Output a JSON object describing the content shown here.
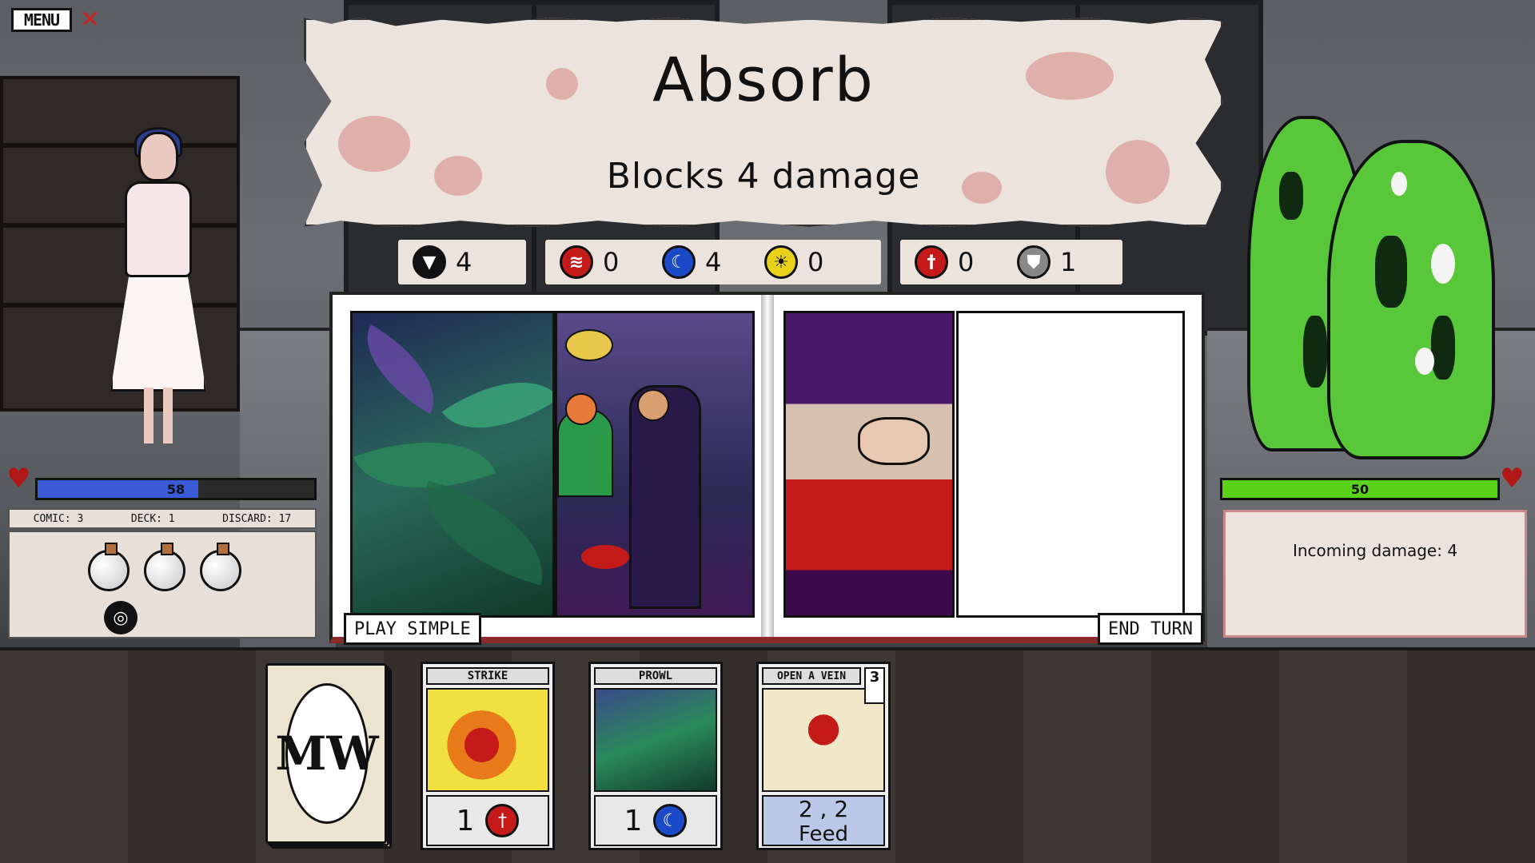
{
  "menu": {
    "label": "MENU",
    "close_glyph": "✕"
  },
  "banner": {
    "title": "Absorb",
    "subtitle": "Blocks 4 damage"
  },
  "resources": {
    "fang": {
      "icon": "fang-icon",
      "value": "4"
    },
    "red": {
      "icon": "red-claw-icon",
      "value": "0",
      "color": "#c41a1a"
    },
    "moon": {
      "icon": "moon-icon",
      "value": "4",
      "color": "#1a4ac8"
    },
    "sun": {
      "icon": "sun-icon",
      "value": "0",
      "color": "#e8d21a"
    },
    "attack": {
      "icon": "sword-icon",
      "value": "0",
      "color": "#c41a1a"
    },
    "shield": {
      "icon": "shield-icon",
      "value": "1",
      "color": "#888888"
    }
  },
  "book": {
    "play_simple": "PLAY SIMPLE",
    "end_turn": "END TURN"
  },
  "player": {
    "hp": "58",
    "hp_fraction": 0.58,
    "hp_color": "#3a5ad8",
    "comic": "COMIC: 3",
    "deck": "DECK: 1",
    "discard": "DISCARD: 17"
  },
  "enemy": {
    "hp": "50",
    "hp_fraction": 1.0,
    "hp_color": "#5ad21a",
    "incoming": "Incoming damage:  4"
  },
  "hand": [
    {
      "name": "STRIKE",
      "cost": "1",
      "icon": "sword-icon",
      "icon_color": "#c41a1a"
    },
    {
      "name": "PROWL",
      "cost": "1",
      "icon": "moon-icon",
      "icon_color": "#1a4ac8"
    },
    {
      "name": "OPEN A VEIN",
      "corner": "3",
      "cost_line": "2 , 2",
      "effect": "Feed"
    }
  ],
  "deck_pile": {
    "logo": "MW"
  }
}
